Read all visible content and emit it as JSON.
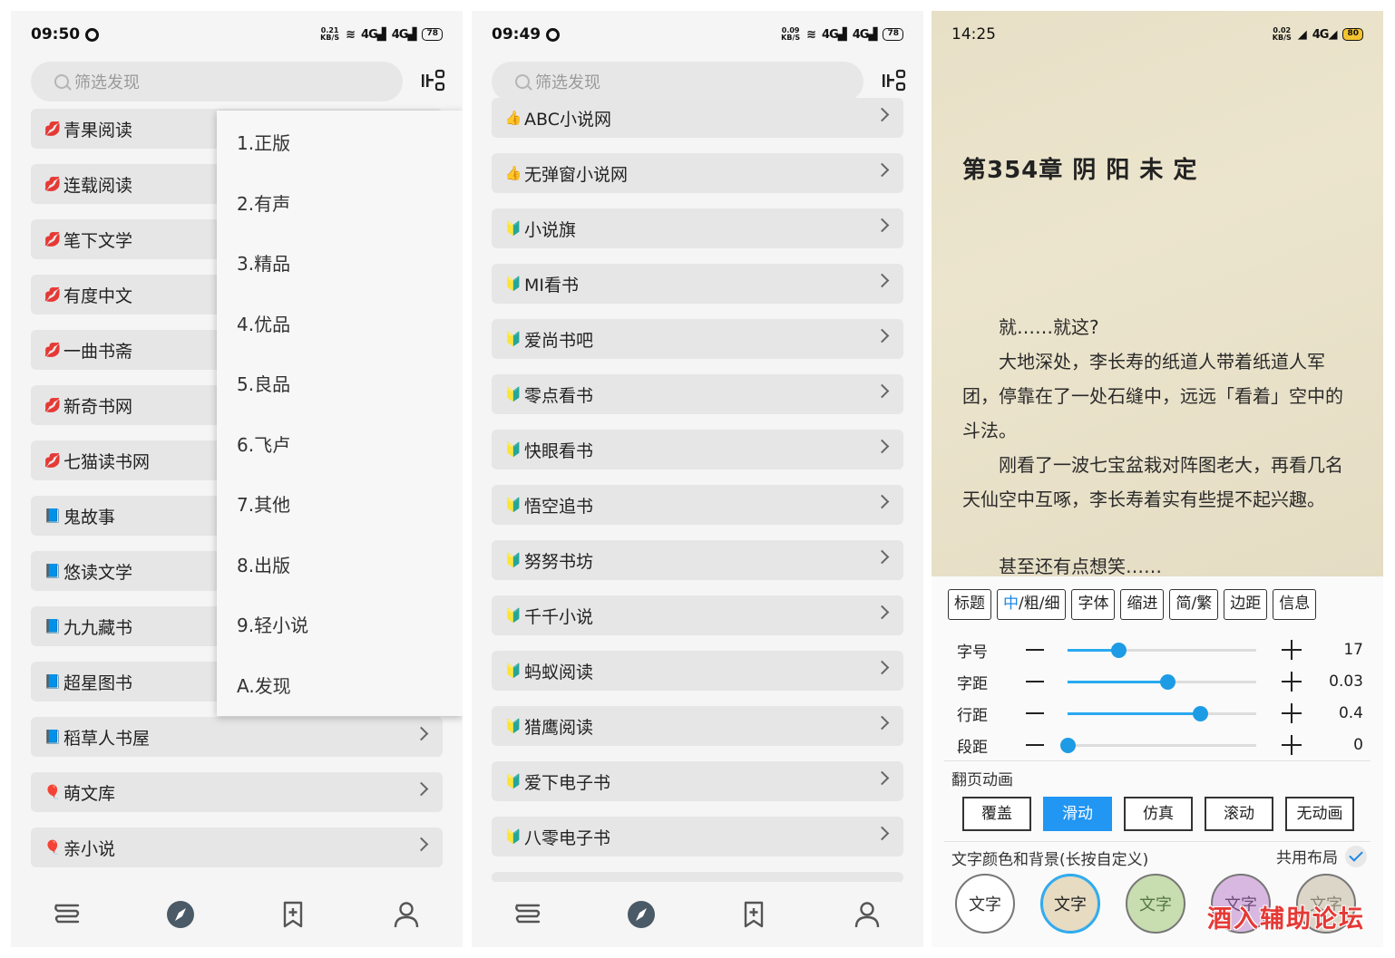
{
  "panel1": {
    "time": "09:50",
    "speed": [
      "0.21",
      "KB/S"
    ],
    "network": "4G",
    "battery": "78",
    "search_placeholder": "筛选发现",
    "items": [
      {
        "emoji": "💋",
        "label": "青果阅读"
      },
      {
        "emoji": "💋",
        "label": "连载阅读"
      },
      {
        "emoji": "💋",
        "label": "笔下文学"
      },
      {
        "emoji": "💋",
        "label": "有度中文"
      },
      {
        "emoji": "💋",
        "label": "一曲书斋"
      },
      {
        "emoji": "💋",
        "label": "新奇书网"
      },
      {
        "emoji": "💋",
        "label": "七猫读书网"
      },
      {
        "emoji": "📘",
        "label": "鬼故事"
      },
      {
        "emoji": "📘",
        "label": "悠读文学"
      },
      {
        "emoji": "📘",
        "label": "九九藏书"
      },
      {
        "emoji": "📘",
        "label": "超星图书"
      },
      {
        "emoji": "📘",
        "label": "稻草人书屋"
      },
      {
        "emoji": "🎈",
        "label": "萌文库"
      },
      {
        "emoji": "🎈",
        "label": "亲小说"
      }
    ],
    "dropdown": [
      "1.正版",
      "2.有声",
      "3.精品",
      "4.优品",
      "5.良品",
      "6.飞卢",
      "7.其他",
      "8.出版",
      "9.轻小说",
      "A.发现"
    ]
  },
  "panel2": {
    "time": "09:49",
    "speed": [
      "0.09",
      "KB/S"
    ],
    "network": "4G",
    "battery": "78",
    "search_placeholder": "筛选发现",
    "items": [
      {
        "emoji": "👍",
        "label": "ABC小说网"
      },
      {
        "emoji": "👍",
        "label": "无弹窗小说网"
      },
      {
        "emoji": "🔰",
        "label": "小说旗"
      },
      {
        "emoji": "🔰",
        "label": "MI看书"
      },
      {
        "emoji": "🔰",
        "label": "爱尚书吧"
      },
      {
        "emoji": "🔰",
        "label": "零点看书"
      },
      {
        "emoji": "🔰",
        "label": "快眼看书"
      },
      {
        "emoji": "🔰",
        "label": "悟空追书"
      },
      {
        "emoji": "🔰",
        "label": "努努书坊"
      },
      {
        "emoji": "🔰",
        "label": "千千小说"
      },
      {
        "emoji": "🔰",
        "label": "蚂蚁阅读"
      },
      {
        "emoji": "🔰",
        "label": "猎鹰阅读"
      },
      {
        "emoji": "🔰",
        "label": "爱下电子书"
      },
      {
        "emoji": "🔰",
        "label": "八零电子书"
      }
    ]
  },
  "panel3": {
    "time": "14:25",
    "speed": [
      "0.02",
      "KB/S"
    ],
    "network": "4G",
    "battery": "80",
    "chapter_title": "第354章 阴 阳 未 定",
    "paragraphs": [
      "　　就……就这?",
      "　　大地深处，李长寿的纸道人带着纸道人军团，停靠在了一处石缝中，远远「看着」空中的斗法。",
      "　　刚看了一波七宝盆栽对阵图老大，再看几名天仙空中互啄，李长寿着实有些提不起兴趣。",
      "　　甚至还有点想笑……"
    ],
    "tabs": [
      "标题",
      "中/粗/细",
      "字体",
      "缩进",
      "简/繁",
      "边距",
      "信息"
    ],
    "tab_active_part": "中",
    "tab_active_rest": "/粗/细",
    "sliders": [
      {
        "label": "字号",
        "value": "17",
        "fraction": 0.27
      },
      {
        "label": "字距",
        "value": "0.03",
        "fraction": 0.53
      },
      {
        "label": "行距",
        "value": "0.4",
        "fraction": 0.7
      },
      {
        "label": "段距",
        "value": "0",
        "fraction": 0.0
      }
    ],
    "anim_label": "翻页动画",
    "anim_options": [
      "覆盖",
      "滑动",
      "仿真",
      "滚动",
      "无动画"
    ],
    "anim_selected": "滑动",
    "color_label": "文字颜色和背景(长按自定义)",
    "shared_label": "共用布局",
    "swatches": [
      {
        "text": "文字",
        "bg": "#ffffff",
        "fg": "#333333"
      },
      {
        "text": "文字",
        "bg": "#e7dbc2",
        "fg": "#222222"
      },
      {
        "text": "文字",
        "bg": "#c8ddb0",
        "fg": "#557744"
      },
      {
        "text": "文字",
        "bg": "#d8b8e0",
        "fg": "#6b4b77"
      },
      {
        "text": "文字",
        "bg": "#dcd6c8",
        "fg": "#8a8575"
      }
    ]
  },
  "watermark": "酒入辅助论坛",
  "colors": {
    "accent": "#2196f3",
    "list_bg": "#e6e6e6",
    "reader_bg": "#e9e1c9"
  }
}
